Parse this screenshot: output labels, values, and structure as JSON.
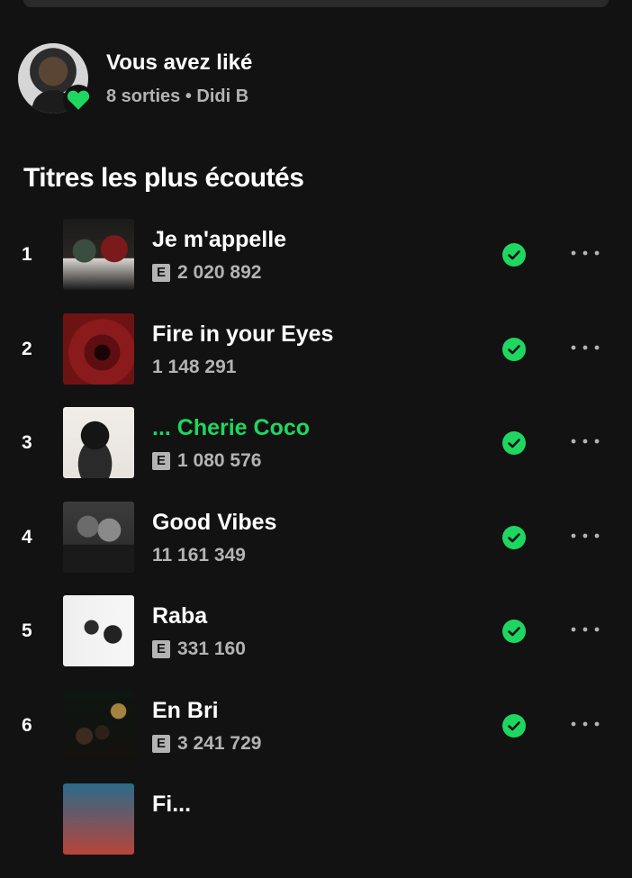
{
  "liked_artist": {
    "title": "Vous avez liké",
    "subtitle": "8 sorties • Didi B",
    "avatar_icon": "artist-photo",
    "badge_icon": "heart-icon"
  },
  "top_tracks": {
    "title": "Titres les plus écoutés",
    "items": [
      {
        "rank": "1",
        "title": "Je m'appelle",
        "plays": "2 020 892",
        "explicit": "E",
        "downloaded": true,
        "playing": false
      },
      {
        "rank": "2",
        "title": "Fire in your Eyes",
        "plays": "1 148 291",
        "explicit": "",
        "downloaded": true,
        "playing": false
      },
      {
        "rank": "3",
        "title": "... Cherie Coco",
        "plays": "1 080 576",
        "explicit": "E",
        "downloaded": true,
        "playing": true
      },
      {
        "rank": "4",
        "title": "Good Vibes",
        "plays": "11 161 349",
        "explicit": "",
        "downloaded": true,
        "playing": false
      },
      {
        "rank": "5",
        "title": "Raba",
        "plays": "331 160",
        "explicit": "E",
        "downloaded": true,
        "playing": false
      },
      {
        "rank": "6",
        "title": "En Bri",
        "plays": "3 241 729",
        "explicit": "E",
        "downloaded": true,
        "playing": false
      },
      {
        "rank": "",
        "title": "Fi...",
        "plays": "",
        "explicit": "",
        "downloaded": false,
        "playing": false
      }
    ]
  },
  "colors": {
    "background": "#121212",
    "accent_green": "#1ed760",
    "secondary_text": "#b3b3b3"
  }
}
